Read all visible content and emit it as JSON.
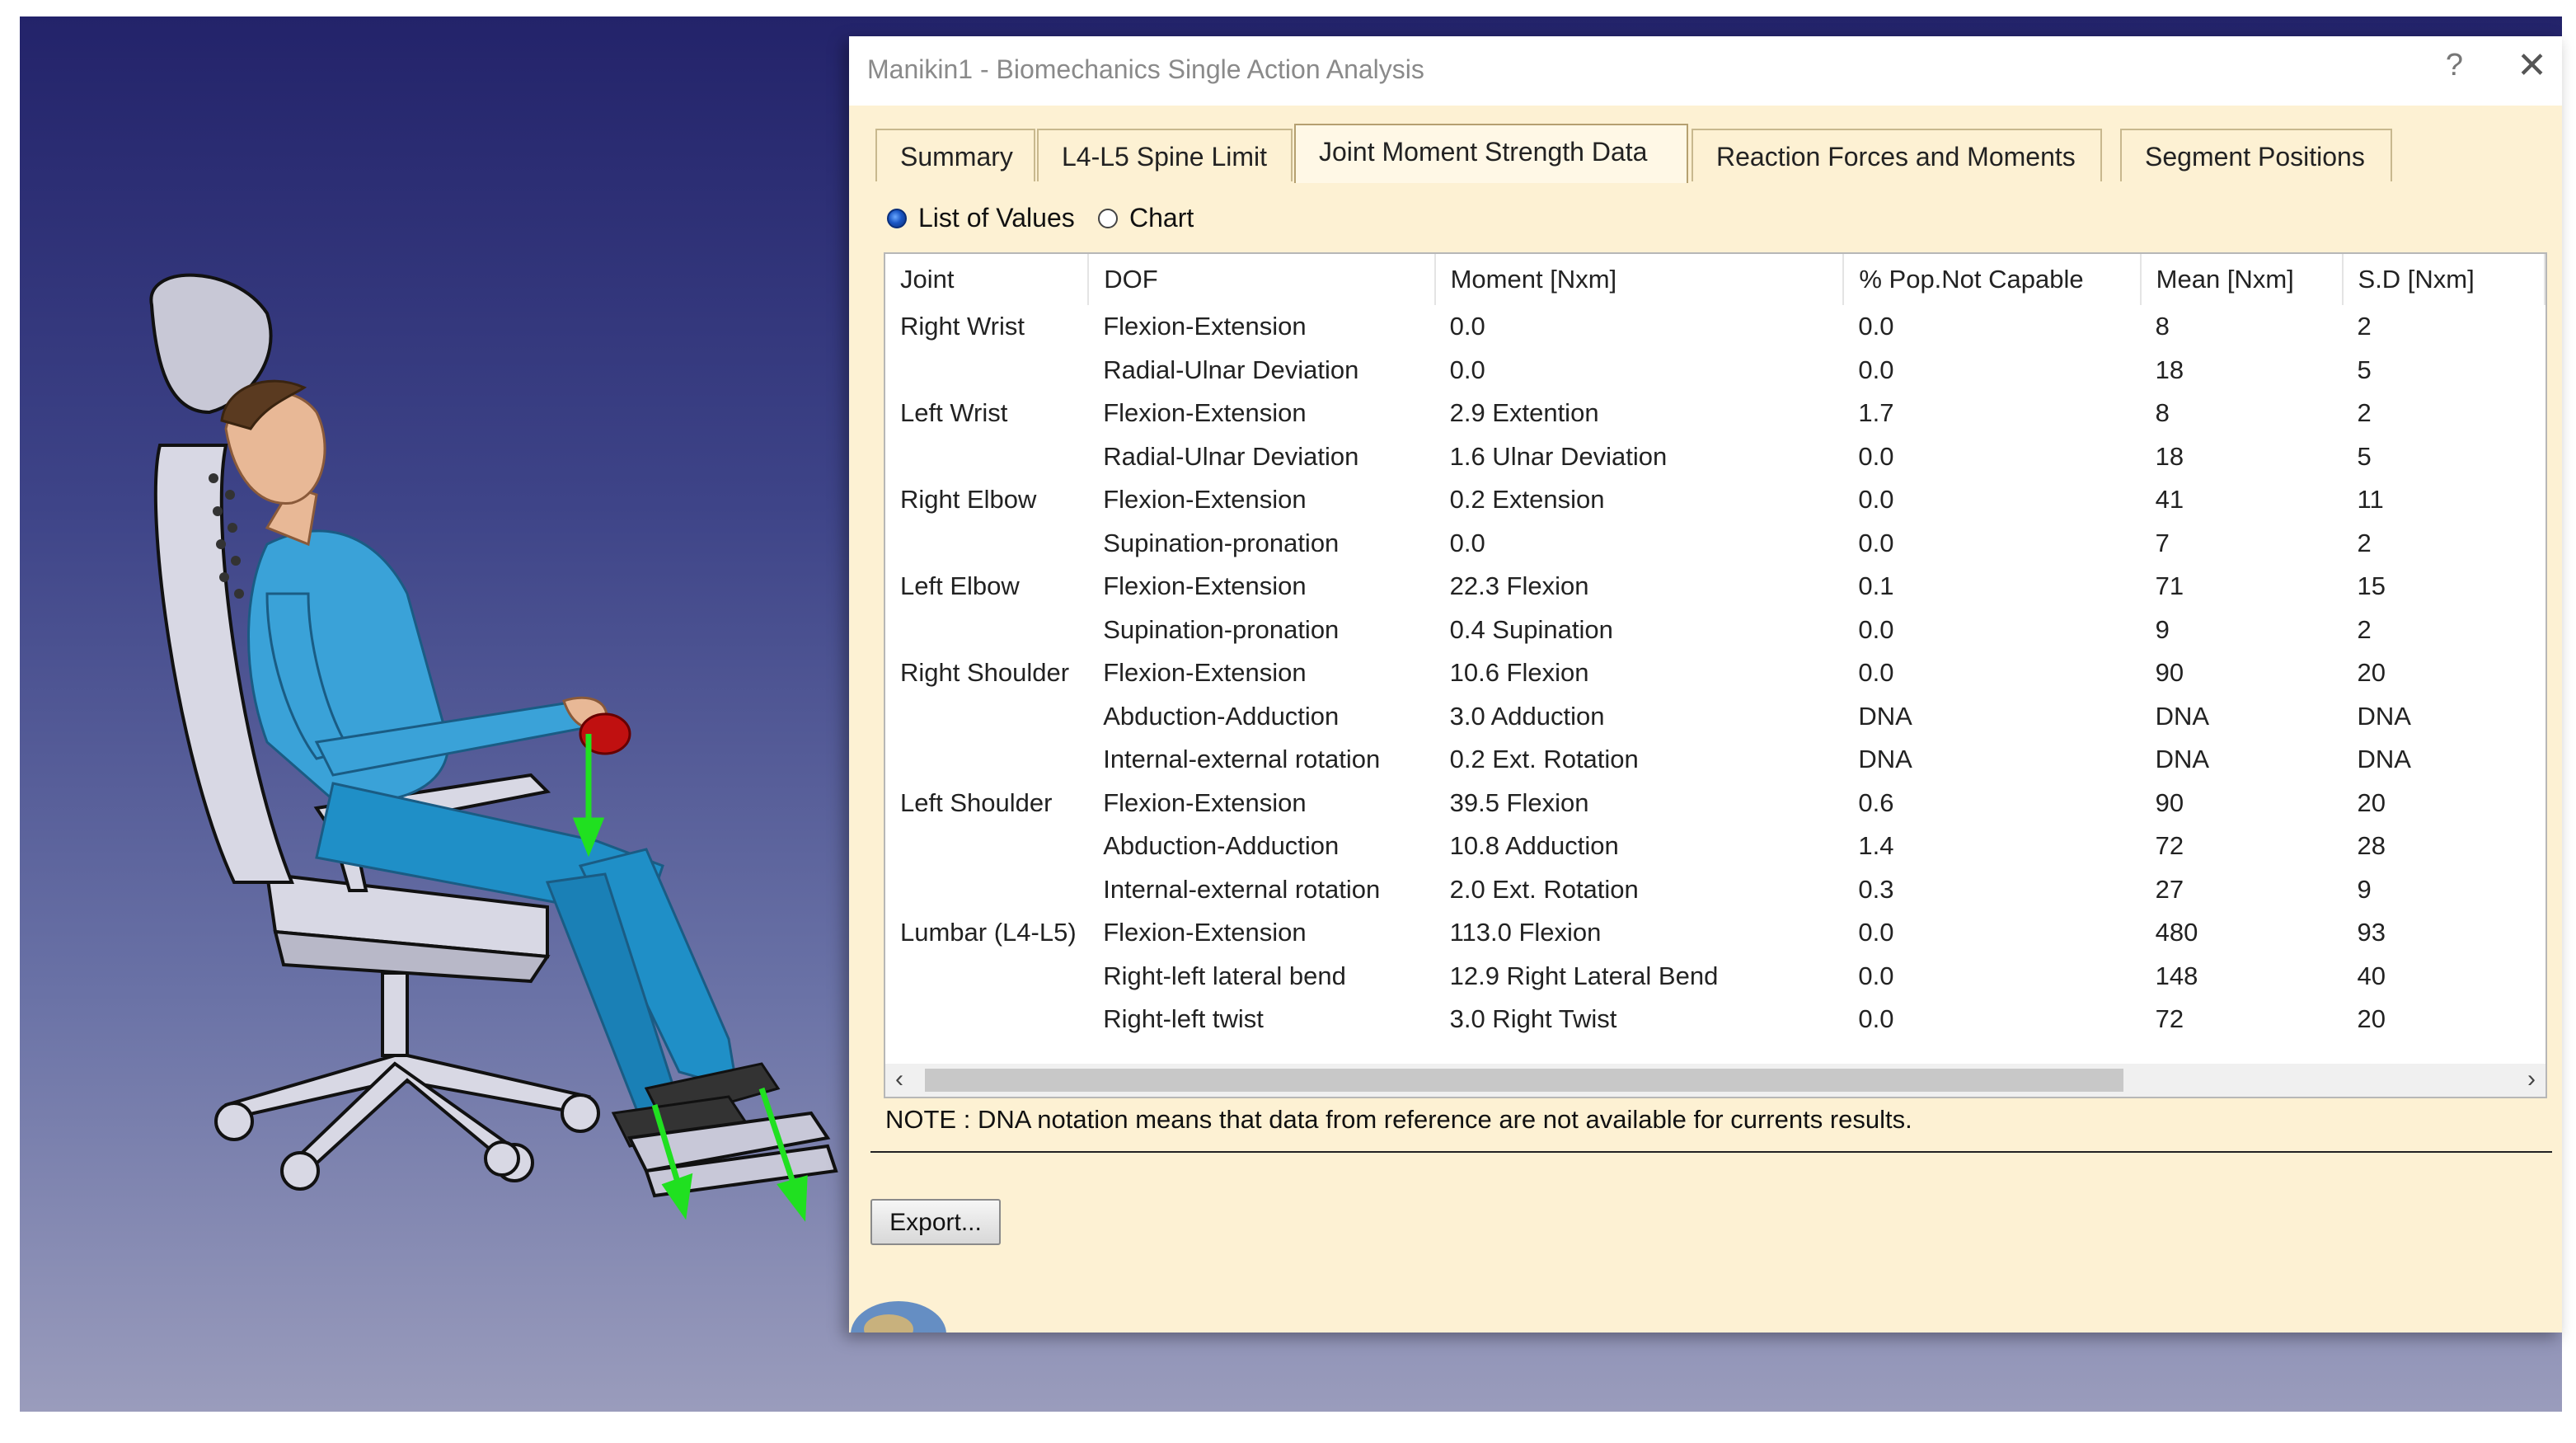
{
  "window": {
    "title": "Manikin1 - Biomechanics Single Action Analysis",
    "help_label": "?",
    "close_label": "✕"
  },
  "tabs": [
    {
      "label": "Summary",
      "active": false
    },
    {
      "label": "L4-L5 Spine Limit",
      "active": false
    },
    {
      "label": "Joint Moment Strength Data",
      "active": true
    },
    {
      "label": "Reaction Forces and Moments",
      "active": false
    },
    {
      "label": "Segment Positions",
      "active": false
    }
  ],
  "view_mode": {
    "list_label": "List of Values",
    "chart_label": "Chart",
    "selected": "List of Values"
  },
  "table": {
    "columns": [
      "Joint",
      "DOF",
      "Moment [Nxm]",
      "% Pop.Not Capable",
      "Mean [Nxm]",
      "S.D [Nxm]"
    ],
    "rows": [
      [
        "Right Wrist",
        "Flexion-Extension",
        "0.0",
        "0.0",
        "8",
        "2"
      ],
      [
        "",
        "Radial-Ulnar Deviation",
        "0.0",
        "0.0",
        "18",
        "5"
      ],
      [
        "Left Wrist",
        "Flexion-Extension",
        "2.9 Extention",
        "1.7",
        "8",
        "2"
      ],
      [
        "",
        "Radial-Ulnar Deviation",
        "1.6 Ulnar Deviation",
        "0.0",
        "18",
        "5"
      ],
      [
        "Right Elbow",
        "Flexion-Extension",
        "0.2 Extension",
        "0.0",
        "41",
        "11"
      ],
      [
        "",
        "Supination-pronation",
        "0.0",
        "0.0",
        "7",
        "2"
      ],
      [
        "Left Elbow",
        "Flexion-Extension",
        "22.3 Flexion",
        "0.1",
        "71",
        "15"
      ],
      [
        "",
        "Supination-pronation",
        "0.4 Supination",
        "0.0",
        "9",
        "2"
      ],
      [
        "Right Shoulder",
        "Flexion-Extension",
        "10.6 Flexion",
        "0.0",
        "90",
        "20"
      ],
      [
        "",
        "Abduction-Adduction",
        "3.0 Adduction",
        "DNA",
        "DNA",
        "DNA"
      ],
      [
        "",
        "Internal-external rotation",
        "0.2 Ext. Rotation",
        "DNA",
        "DNA",
        "DNA"
      ],
      [
        "Left Shoulder",
        "Flexion-Extension",
        "39.5 Flexion",
        "0.6",
        "90",
        "20"
      ],
      [
        "",
        "Abduction-Adduction",
        "10.8 Adduction",
        "1.4",
        "72",
        "28"
      ],
      [
        "",
        "Internal-external rotation",
        "2.0 Ext. Rotation",
        "0.3",
        "27",
        "9"
      ],
      [
        "Lumbar (L4-L5)",
        "Flexion-Extension",
        "113.0 Flexion",
        "0.0",
        "480",
        "93"
      ],
      [
        "",
        "Right-left lateral bend",
        "12.9 Right Lateral Bend",
        "0.0",
        "148",
        "40"
      ],
      [
        "",
        "Right-left twist",
        "3.0 Right Twist",
        "0.0",
        "72",
        "20"
      ]
    ]
  },
  "scrollbar": {
    "left_arrow": "‹",
    "right_arrow": "›"
  },
  "note": "NOTE : DNA notation means that data from reference are not available for currents results.",
  "export_label": "Export...",
  "colors": {
    "dialog_bg": "#fdf1d3",
    "viewport_top": "#23236a",
    "viewport_bottom": "#9a9cbc",
    "manikin_skin": "#3aa2d8",
    "chair": "#d8d8e4",
    "force_arrow": "#20e020",
    "load_ball": "#c01010"
  }
}
